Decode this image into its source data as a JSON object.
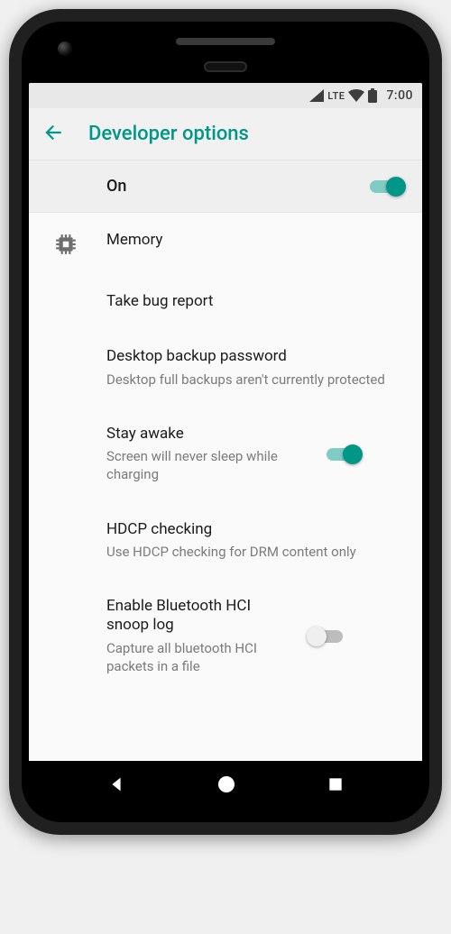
{
  "status_bar": {
    "network_label": "LTE",
    "clock": "7:00"
  },
  "app_bar": {
    "title": "Developer options"
  },
  "master_toggle": {
    "label": "On",
    "state": "on"
  },
  "items": [
    {
      "title": "Memory",
      "subtitle": "",
      "has_icon": true,
      "icon": "memory-chip-icon",
      "has_toggle": false
    },
    {
      "title": "Take bug report",
      "subtitle": "",
      "has_icon": false,
      "has_toggle": false
    },
    {
      "title": "Desktop backup password",
      "subtitle": "Desktop full backups aren't currently protected",
      "has_icon": false,
      "has_toggle": false
    },
    {
      "title": "Stay awake",
      "subtitle": "Screen will never sleep while charging",
      "has_icon": false,
      "has_toggle": true,
      "toggle_state": "on"
    },
    {
      "title": "HDCP checking",
      "subtitle": "Use HDCP checking for DRM content only",
      "has_icon": false,
      "has_toggle": false
    },
    {
      "title": "Enable Bluetooth HCI snoop log",
      "subtitle": "Capture all bluetooth HCI packets in a file",
      "has_icon": false,
      "has_toggle": true,
      "toggle_state": "off"
    }
  ],
  "colors": {
    "accent": "#009688",
    "accent_light": "#80cbc4"
  }
}
